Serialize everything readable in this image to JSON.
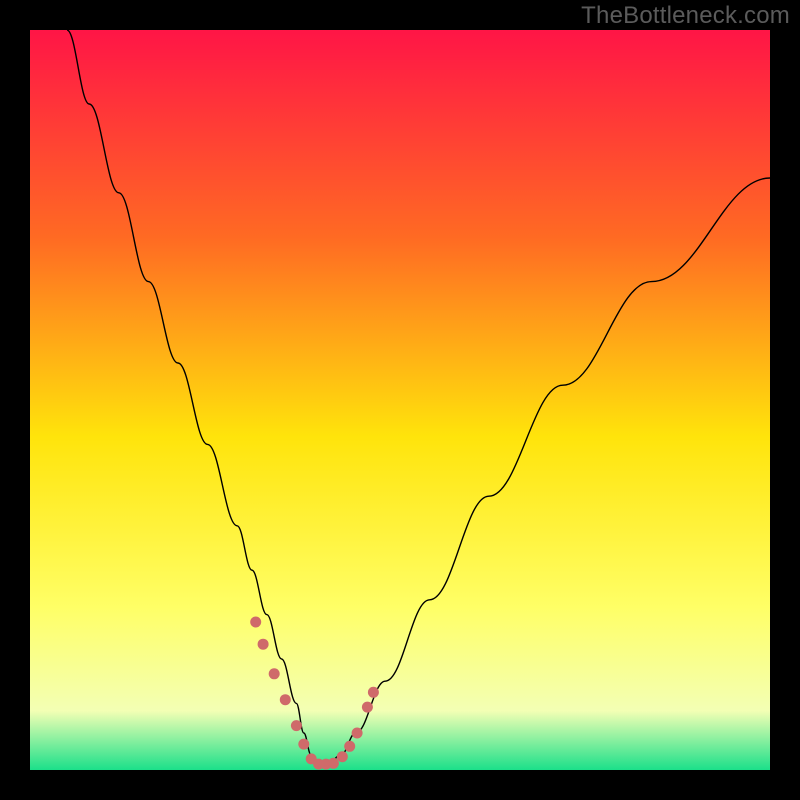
{
  "watermark": "TheBottleneck.com",
  "chart_data": {
    "type": "line",
    "title": "",
    "xlabel": "",
    "ylabel": "",
    "xlim": [
      0,
      100
    ],
    "ylim": [
      0,
      100
    ],
    "axes_visible": false,
    "grid": false,
    "gradient": {
      "top": "#ff1546",
      "mid_upper": "#ff6a23",
      "mid": "#ffe40b",
      "mid_lower": "#ffff66",
      "near_bottom": "#f3ffb4",
      "bottom": "#1be08a"
    },
    "series": [
      {
        "name": "bottleneck-curve",
        "color": "#000000",
        "stroke_width": 1.4,
        "x": [
          5,
          8,
          12,
          16,
          20,
          24,
          28,
          30,
          32,
          34,
          36,
          37,
          38,
          39,
          40,
          42,
          44,
          48,
          54,
          62,
          72,
          84,
          100
        ],
        "y": [
          100,
          90,
          78,
          66,
          55,
          44,
          33,
          27,
          21,
          15,
          9,
          5,
          2,
          0.5,
          0.5,
          2,
          5,
          12,
          23,
          37,
          52,
          66,
          80
        ]
      },
      {
        "name": "sweet-spot-markers",
        "color": "#cf6a6a",
        "type": "scatter",
        "marker_size": 11,
        "x": [
          30.5,
          31.5,
          33.0,
          34.5,
          36.0,
          37.0,
          38.0,
          39.0,
          40.0,
          41.0,
          42.2,
          43.2,
          44.2,
          45.6,
          46.4
        ],
        "y": [
          20.0,
          17.0,
          13.0,
          9.5,
          6.0,
          3.5,
          1.5,
          0.8,
          0.8,
          0.9,
          1.8,
          3.2,
          5.0,
          8.5,
          10.5
        ]
      }
    ],
    "annotations": []
  }
}
